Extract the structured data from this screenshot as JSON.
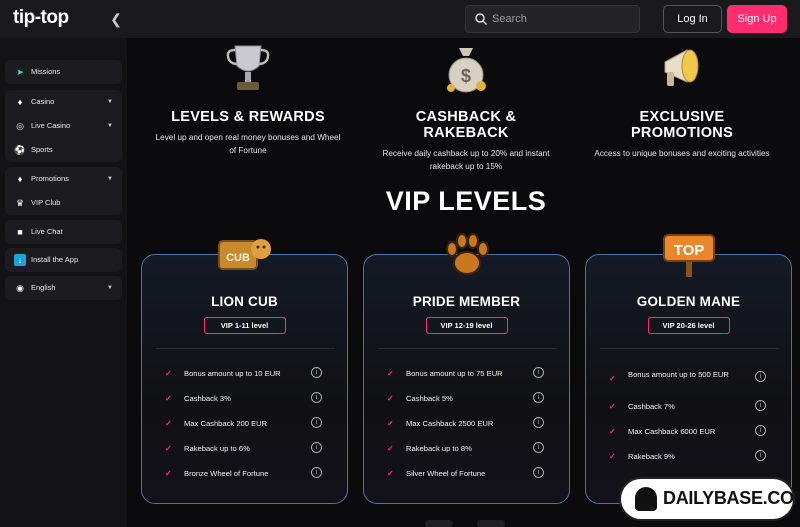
{
  "brand": {
    "logo_text": "tip-top",
    "accent": "#ff2d6f"
  },
  "header": {
    "search_placeholder": "Search",
    "login_label": "Log In",
    "signup_label": "Sign Up"
  },
  "sidebar": {
    "groups": [
      {
        "items": [
          {
            "label": "Missions",
            "icon": "rocket-icon"
          }
        ]
      },
      {
        "items": [
          {
            "label": "Casino",
            "icon": "casino-chip-icon",
            "chevron": true
          },
          {
            "label": "Live Casino",
            "icon": "live-target-icon",
            "chevron": true
          },
          {
            "label": "Sports",
            "icon": "basketball-icon"
          }
        ]
      },
      {
        "items": [
          {
            "label": "Promotions",
            "icon": "tag-icon",
            "chevron": true
          },
          {
            "label": "VIP Club",
            "icon": "crown-icon"
          }
        ]
      },
      {
        "items": [
          {
            "label": "Live Chat",
            "icon": "chat-bubble-icon"
          }
        ]
      },
      {
        "items": [
          {
            "label": "Install the App",
            "icon": "download-icon"
          }
        ]
      },
      {
        "items": [
          {
            "label": "English",
            "icon": "globe-icon",
            "chevron": true
          }
        ]
      }
    ]
  },
  "features": [
    {
      "title": "LEVELS & REWARDS",
      "desc": "Level up and open real money bonuses and Wheel of Fortune",
      "icon": "trophy-icon"
    },
    {
      "title": "CASHBACK & RAKEBACK",
      "desc": "Receive daily cashback up to 20% and instant rakeback up to 15%",
      "icon": "money-bag-icon"
    },
    {
      "title": "EXCLUSIVE PROMOTIONS",
      "desc": "Access to unique bonuses and exciting activities",
      "icon": "megaphone-icon"
    }
  ],
  "vip": {
    "title": "VIP LEVELS",
    "cards": [
      {
        "name": "LION CUB",
        "level": "VIP 1-11 level",
        "badge": "lion-cub-badge-icon",
        "badge_text": "CUB",
        "benefits": [
          "Bonus amount up to 10 EUR",
          "Cashback 3%",
          "Max Cashback 200 EUR",
          "Rakeback up to 6%",
          "Bronze Wheel of Fortune"
        ]
      },
      {
        "name": "PRIDE MEMBER",
        "level": "VIP 12-19 level",
        "badge": "paw-badge-icon",
        "benefits": [
          "Bonus amount up to 75 EUR",
          "Cashback 5%",
          "Max Cashback 2500 EUR",
          "Rakeback up to 8%",
          "Silver Wheel of Fortune"
        ]
      },
      {
        "name": "GOLDEN MANE",
        "level": "VIP 20-26 level",
        "badge": "top-sign-badge-icon",
        "badge_text": "TOP",
        "benefits": [
          "Bonus amount up to 500 EUR",
          "Cashback 7%",
          "Max Cashback 6000 EUR",
          "Rakeback 9%"
        ]
      }
    ]
  },
  "watermark": {
    "text": "DAILYBASE.COM"
  }
}
